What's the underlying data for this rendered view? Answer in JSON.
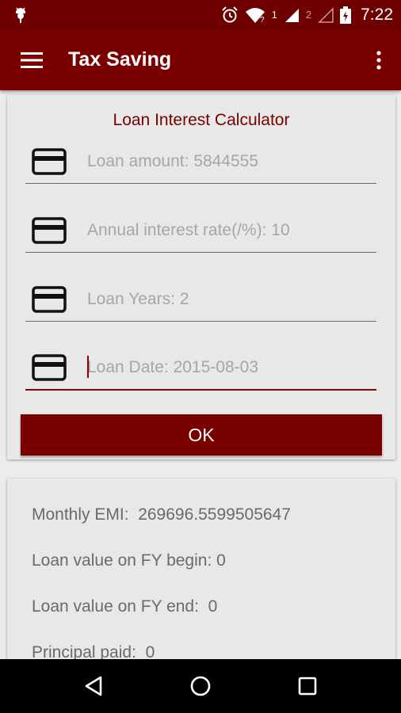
{
  "status_bar": {
    "time": "7:22",
    "sim1": "1",
    "sim2": "2",
    "icons": [
      "android-debug-icon",
      "alarm-icon",
      "wifi-icon",
      "signal-icon",
      "signal-icon",
      "battery-charging-icon"
    ]
  },
  "app_bar": {
    "title": "Tax Saving",
    "menu_icon": "hamburger-menu-icon",
    "overflow_icon": "more-vert-icon"
  },
  "calculator": {
    "title": "Loan Interest Calculator",
    "fields": [
      {
        "placeholder": "Loan amount: 5844555",
        "icon": "credit-card-icon"
      },
      {
        "placeholder": "Annual interest rate(/%): 10",
        "icon": "credit-card-icon"
      },
      {
        "placeholder": "Loan Years: 2",
        "icon": "credit-card-icon"
      },
      {
        "placeholder": "Loan Date: 2015-08-03",
        "icon": "credit-card-icon"
      }
    ],
    "ok_label": "OK"
  },
  "results": {
    "monthly_emi": "Monthly EMI:  269696.5599505647",
    "fy_begin": "Loan value on FY begin: 0",
    "fy_end": "Loan value on FY end:  0",
    "principal_paid": "Principal paid:  0"
  },
  "colors": {
    "primary": "#7a0000",
    "primary_dark": "#6e0000",
    "background": "#ececec",
    "card": "#e8e8e8"
  }
}
